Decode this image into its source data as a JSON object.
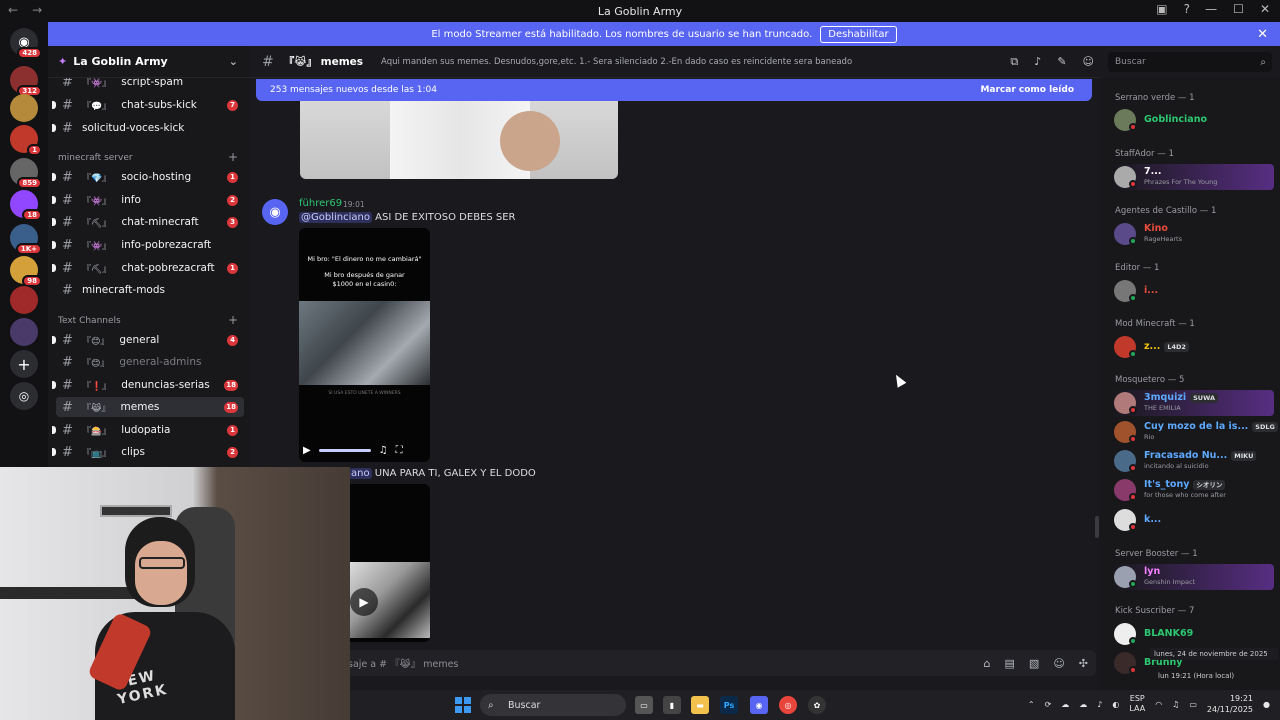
{
  "window": {
    "title": "La Goblin Army"
  },
  "streamer_bar": {
    "text": "El modo Streamer está habilitado. Los nombres de usuario se han truncado.",
    "button": "Deshabilitar"
  },
  "guild": {
    "name": "La Goblin Army"
  },
  "channels": {
    "items": [
      {
        "emoji": "『👾』",
        "name": "script-spam",
        "badge": ""
      },
      {
        "emoji": "『💬』",
        "name": "chat-subs-kick",
        "badge": "7"
      },
      {
        "emoji": "",
        "name": "solicitud-voces-kick",
        "badge": ""
      },
      {
        "emoji": "『💎』",
        "name": "socio-hosting",
        "badge": "1"
      },
      {
        "emoji": "『👾』",
        "name": "info",
        "badge": "2"
      },
      {
        "emoji": "『⛏』",
        "name": "chat-minecraft",
        "badge": "3"
      },
      {
        "emoji": "『👾』",
        "name": "info-pobrezacraft",
        "badge": ""
      },
      {
        "emoji": "『⛏』",
        "name": "chat-pobrezacraft",
        "badge": "1"
      },
      {
        "emoji": "",
        "name": "minecraft-mods",
        "badge": ""
      },
      {
        "emoji": "『😊』",
        "name": "general",
        "badge": "4"
      },
      {
        "emoji": "『😊』",
        "name": "general-admins",
        "badge": ""
      },
      {
        "emoji": "『❗』",
        "name": "denuncias-serias",
        "badge": "18"
      },
      {
        "emoji": "『😹』",
        "name": "memes",
        "badge": "18"
      },
      {
        "emoji": "『🎰』",
        "name": "ludopatia",
        "badge": "1"
      },
      {
        "emoji": "『📺』",
        "name": "clips",
        "badge": "2"
      }
    ],
    "categories": [
      "minecraft server",
      "Text Channels"
    ]
  },
  "header": {
    "channel": "『😹』 memes",
    "topic": "Aqui manden sus memes. Desnudos,gore,etc. 1.- Sera silenciado 2.-En dado caso es reincidente sera baneado",
    "search_placeholder": "Buscar"
  },
  "new_messages": {
    "text": "253 mensajes nuevos desde las 1:04",
    "action": "Marcar como leído"
  },
  "messages": {
    "m1_author": "führer69",
    "m1_time": "19:01",
    "m1_mention": "@Goblinciano",
    "m1_text": " ASI DE EXITOSO DEBES SER",
    "video_cap1": "Mi bro: \"El dinero no me cambiará\"",
    "video_cap2": "Mi bro después de ganar $1000 en el casin0:",
    "video_small": "SI USA ESTO UNETE A WINNERS",
    "m2_mention": "ano",
    "m2_text": " UNA PARA TI, GALEX Y EL DODO"
  },
  "input": {
    "placeholder": "saje a # 『😹』 memes"
  },
  "members": {
    "groups": [
      "Serrano verde — 1",
      "StaffAdor — 1",
      "Agentes de Castillo — 1",
      "Editor — 1",
      "Mod Minecraft — 1",
      "Mosquetero — 5",
      "Server Booster — 1",
      "Kick Suscriber — 7"
    ],
    "list": [
      {
        "name": "Goblinciano",
        "activity": "",
        "tag": "",
        "color": "#2dc770"
      },
      {
        "name": "7...",
        "activity": "Phrazes For The Young",
        "tag": "",
        "color": "#ffffff"
      },
      {
        "name": "Kino",
        "activity": "RageHearts",
        "tag": "",
        "color": "#e74c3c"
      },
      {
        "name": "i...",
        "activity": "",
        "tag": "",
        "color": "#e74c3c"
      },
      {
        "name": "z...",
        "activity": "",
        "tag": "L4D2",
        "color": "#f1c40f"
      },
      {
        "name": "3mquizi",
        "activity": "THE EMILIA",
        "tag": "SUWA",
        "color": "#5da9ff"
      },
      {
        "name": "Cuy mozo de la is...",
        "activity": "Rio",
        "tag": "SDLG",
        "color": "#5da9ff"
      },
      {
        "name": "Fracasado Nu...",
        "activity": "incitando al suicidio",
        "tag": "MIKU",
        "color": "#5da9ff"
      },
      {
        "name": "It's_tony",
        "activity": "for those who come after",
        "tag": "シオリン",
        "color": "#5da9ff"
      },
      {
        "name": "k...",
        "activity": "",
        "tag": "",
        "color": "#5da9ff"
      },
      {
        "name": "lyn",
        "activity": "Genshin Impact",
        "tag": "",
        "color": "#f47fff"
      },
      {
        "name": "BLANK69",
        "activity": "",
        "tag": "",
        "color": "#2dc770"
      },
      {
        "name": "Brunny",
        "activity": "",
        "tag": "",
        "color": "#2dc770"
      }
    ]
  },
  "taskbar": {
    "search": "Buscar",
    "lang": "ESP",
    "lang2": "LAA",
    "time": "19:21",
    "date": "24/11/2025",
    "tooltip_date": "lunes, 24 de noviembre de 2025",
    "tooltip_time": "lun 19:21 (Hora local)"
  },
  "server_badges": [
    "428",
    "312",
    "1",
    "859",
    "18",
    "1K+",
    "98"
  ],
  "colors": {
    "accent": "#5865f2",
    "danger": "#da373c",
    "online": "#23a55a"
  }
}
